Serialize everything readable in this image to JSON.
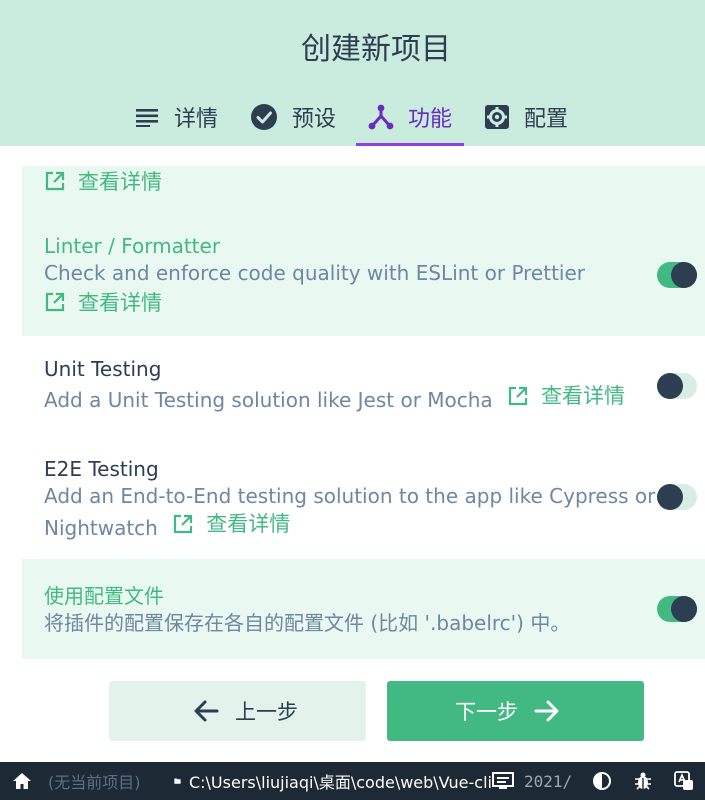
{
  "page_title": "创建新项目",
  "tabs": [
    {
      "label": "详情",
      "icon": "list-icon"
    },
    {
      "label": "预设",
      "icon": "check-circle-icon"
    },
    {
      "label": "功能",
      "icon": "merge-icon"
    },
    {
      "label": "配置",
      "icon": "gear-icon"
    }
  ],
  "active_tab": "功能",
  "features": {
    "partial_more": "查看详情",
    "linter": {
      "name": "Linter / Formatter",
      "desc": "Check and enforce code quality with ESLint or Prettier",
      "more": "查看详情",
      "enabled": true
    },
    "unit": {
      "name": "Unit Testing",
      "desc": "Add a Unit Testing solution like Jest or Mocha",
      "more": "查看详情",
      "enabled": false
    },
    "e2e": {
      "name": "E2E Testing",
      "desc": "Add an End-to-End testing solution to the app like Cypress or",
      "desc2": "Nightwatch",
      "more": "查看详情",
      "enabled": false
    },
    "config": {
      "name": "使用配置文件",
      "desc": "将插件的配置保存在各自的配置文件 (比如 '.babelrc') 中。",
      "enabled": true
    }
  },
  "buttons": {
    "prev": "上一步",
    "next": "下一步"
  },
  "statusbar": {
    "project": "(无当前项目)",
    "path": "C:\\Users\\liujiaqi\\桌面\\code\\web\\Vue-cli",
    "log": "2021/"
  },
  "colors": {
    "accent": "#42b983",
    "active_tab": "#6a2bc2",
    "header_bg": "#c9ecdf",
    "statusbar_bg": "#1d2935"
  }
}
